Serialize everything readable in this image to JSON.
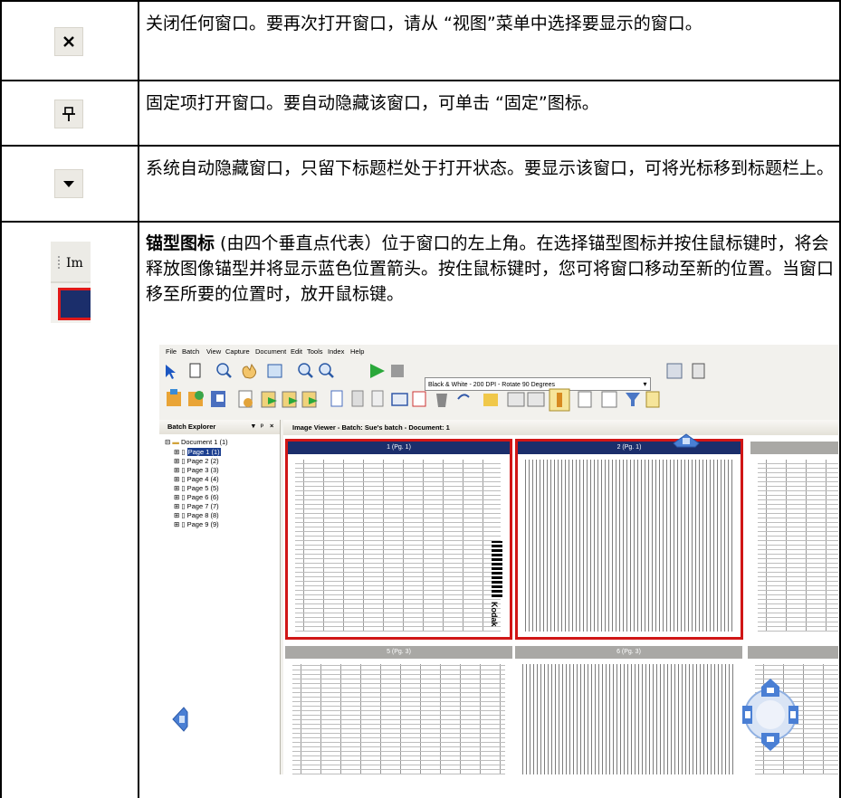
{
  "rows": [
    {
      "icon": "close-icon",
      "text": "关闭任何窗口。要再次打开窗口，请从 “视图”菜单中选择要显示的窗口。"
    },
    {
      "icon": "pin-icon",
      "text": "固定项打开窗口。要自动隐藏该窗口，可单击 “固定”图标。"
    },
    {
      "icon": "dropdown-arrow-icon",
      "text": "系统自动隐藏窗口，只留下标题栏处于打开状态。要显示该窗口，可将光标移到标题栏上。"
    },
    {
      "icon": "anchor-grip-icon",
      "text_bold": "锚型图标",
      "text": " (由四个垂直点代表）位于窗口的左上角。在选择锚型图标并按住鼠标键时，将会释放图像锚型并将显示蓝色位置箭头。按住鼠标键时，您可将窗口移动至新的位置。当窗口移至所要的位置时，放开鼠标键。",
      "anchor_caption": "Im"
    }
  ],
  "screenshot": {
    "menu": [
      "File",
      "Batch",
      "View",
      "Capture",
      "Document",
      "Edit",
      "Tools",
      "Index",
      "Help"
    ],
    "profile_dropdown": "Black & White - 200 DPI - Rotate 90 Degrees",
    "explorer_title": "Batch Explorer",
    "tree": [
      "Document 1 (1)",
      "Page 1 (1)",
      "Page 2 (2)",
      "Page 3 (3)",
      "Page 4 (4)",
      "Page 5 (5)",
      "Page 6 (6)",
      "Page 7 (7)",
      "Page 8 (8)",
      "Page 9 (9)"
    ],
    "viewer_title": "Image Viewer - Batch: Sue's batch - Document: 1",
    "thumbs": [
      "1 (Pg. 1)",
      "2 (Pg. 1)",
      "5 (Pg. 3)",
      "6 (Pg. 3)"
    ],
    "kodak": "Kodak",
    "colors": {
      "selection": "#d01616",
      "title_selected": "#1b2e6b",
      "arrow": "#4a7fd4"
    }
  }
}
